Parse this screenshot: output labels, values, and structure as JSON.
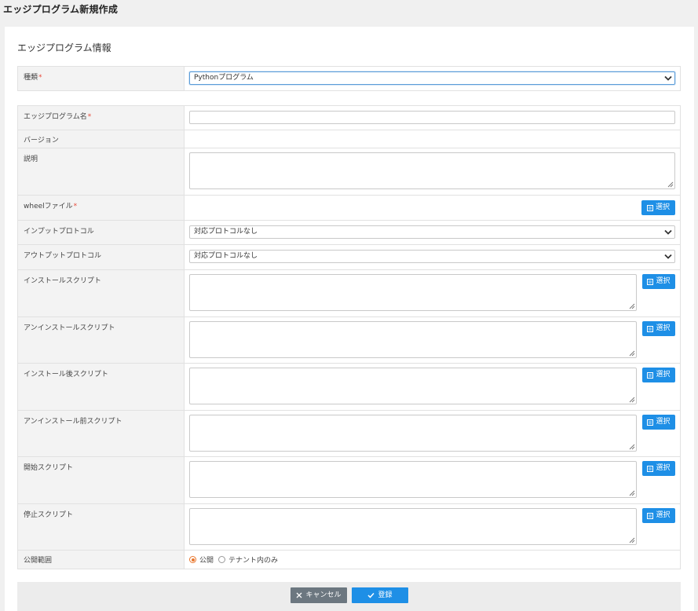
{
  "page": {
    "title": "エッジプログラム新規作成"
  },
  "section": {
    "title": "エッジプログラム情報"
  },
  "type_row": {
    "label": "種類",
    "required": "*",
    "selected": "Pythonプログラム"
  },
  "fields": {
    "name": {
      "label": "エッジプログラム名",
      "required": "*",
      "value": ""
    },
    "version": {
      "label": "バージョン",
      "value": ""
    },
    "description": {
      "label": "説明",
      "value": ""
    },
    "wheel": {
      "label": "wheelファイル",
      "required": "*",
      "button": "選択"
    },
    "input_protocol": {
      "label": "インプットプロトコル",
      "selected": "対応プロトコルなし"
    },
    "output_protocol": {
      "label": "アウトプットプロトコル",
      "selected": "対応プロトコルなし"
    },
    "install_script": {
      "label": "インストールスクリプト",
      "button": "選択"
    },
    "uninstall_script": {
      "label": "アンインストールスクリプト",
      "button": "選択"
    },
    "post_install_script": {
      "label": "インストール後スクリプト",
      "button": "選択"
    },
    "pre_uninstall_script": {
      "label": "アンインストール前スクリプト",
      "button": "選択"
    },
    "start_script": {
      "label": "開始スクリプト",
      "button": "選択"
    },
    "stop_script": {
      "label": "停止スクリプト",
      "button": "選択"
    },
    "visibility": {
      "label": "公開範囲",
      "options": [
        "公開",
        "テナント内のみ"
      ],
      "selected": "公開"
    }
  },
  "footer": {
    "cancel": "キャンセル",
    "submit": "登録"
  },
  "colors": {
    "primary": "#1e8fe6",
    "cancel": "#6c7780",
    "required": "#e74c3c",
    "radio": "#e8772e"
  },
  "icons": {
    "chevron": "chevron-down-icon",
    "document": "document-icon",
    "close": "close-icon",
    "check": "check-icon"
  }
}
